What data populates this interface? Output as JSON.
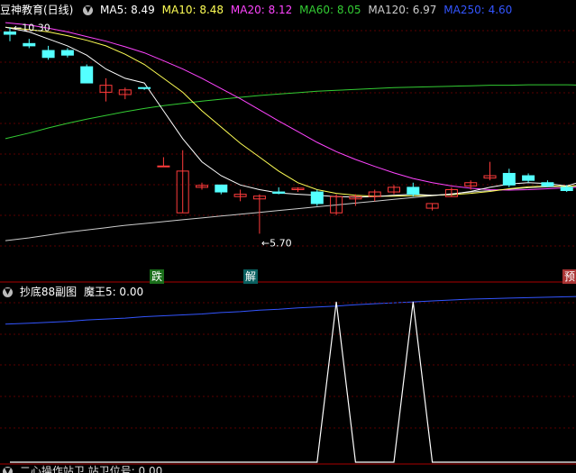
{
  "main_legend": {
    "title": "豆神教育(日线)",
    "ma5": "MA5: 8.49",
    "ma10": "MA10: 8.48",
    "ma20": "MA20: 8.12",
    "ma60": "MA60: 8.05",
    "ma120": "MA120: 6.97",
    "ma250": "MA250: 4.60"
  },
  "high_label": "10.30",
  "low_label": "5.70",
  "tags": {
    "die": "跌",
    "jie": "解",
    "yu": "预"
  },
  "sub_legend": {
    "title": "抄底88副图",
    "value": "魔王5: 0.00"
  },
  "bottom_legend": "二心操作站卫  站卫位号: 0.00",
  "colors": {
    "background": "#000000",
    "grid": "#5a0000",
    "up_candle": "#ff3b3b",
    "down_candle": "#54ffff",
    "ma5": "#ffffff",
    "ma10": "#ffff55",
    "ma20": "#ff44ff",
    "ma60": "#33cc33",
    "ma120": "#cccccc",
    "ma250": "#3355ff",
    "tag_green": "#1a6e1a",
    "tag_teal": "#0a6060",
    "tag_red": "#aa3333"
  },
  "chart_data": {
    "type": "candlestick",
    "price_range": [
      5.2,
      10.6
    ],
    "candles": [
      {
        "o": 10.3,
        "h": 10.4,
        "l": 10.1,
        "c": 10.25
      },
      {
        "o": 10.05,
        "h": 10.15,
        "l": 9.95,
        "c": 10.0
      },
      {
        "o": 9.9,
        "h": 10.0,
        "l": 9.7,
        "c": 9.75
      },
      {
        "o": 9.9,
        "h": 9.95,
        "l": 9.75,
        "c": 9.8
      },
      {
        "o": 9.55,
        "h": 9.6,
        "l": 9.2,
        "c": 9.2
      },
      {
        "o": 9.0,
        "h": 9.3,
        "l": 8.8,
        "c": 9.15
      },
      {
        "o": 8.95,
        "h": 9.1,
        "l": 8.85,
        "c": 9.05
      },
      {
        "o": 9.1,
        "h": 9.1,
        "l": 9.05,
        "c": 9.08
      },
      {
        "o": 7.4,
        "h": 7.6,
        "l": 7.4,
        "c": 7.41
      },
      {
        "o": 6.4,
        "h": 7.75,
        "l": 6.4,
        "c": 7.3
      },
      {
        "o": 6.95,
        "h": 7.05,
        "l": 6.9,
        "c": 6.99
      },
      {
        "o": 7.0,
        "h": 7.0,
        "l": 6.8,
        "c": 6.85
      },
      {
        "o": 6.75,
        "h": 6.9,
        "l": 6.65,
        "c": 6.8
      },
      {
        "o": 6.7,
        "h": 6.8,
        "l": 5.95,
        "c": 6.76
      },
      {
        "o": 6.85,
        "h": 6.95,
        "l": 6.8,
        "c": 6.82
      },
      {
        "o": 6.9,
        "h": 6.95,
        "l": 6.85,
        "c": 6.93
      },
      {
        "o": 6.85,
        "h": 6.9,
        "l": 6.55,
        "c": 6.6
      },
      {
        "o": 6.4,
        "h": 6.8,
        "l": 6.35,
        "c": 6.75
      },
      {
        "o": 6.7,
        "h": 6.8,
        "l": 6.55,
        "c": 6.75
      },
      {
        "o": 6.75,
        "h": 6.9,
        "l": 6.65,
        "c": 6.85
      },
      {
        "o": 6.85,
        "h": 7.0,
        "l": 6.8,
        "c": 6.95
      },
      {
        "o": 6.95,
        "h": 7.05,
        "l": 6.75,
        "c": 6.8
      },
      {
        "o": 6.5,
        "h": 6.6,
        "l": 6.45,
        "c": 6.6
      },
      {
        "o": 6.75,
        "h": 6.95,
        "l": 6.75,
        "c": 6.9
      },
      {
        "o": 6.98,
        "h": 7.1,
        "l": 6.9,
        "c": 7.05
      },
      {
        "o": 7.15,
        "h": 7.5,
        "l": 7.1,
        "c": 7.2
      },
      {
        "o": 7.25,
        "h": 7.35,
        "l": 6.95,
        "c": 7.0
      },
      {
        "o": 7.2,
        "h": 7.25,
        "l": 7.05,
        "c": 7.1
      },
      {
        "o": 7.05,
        "h": 7.1,
        "l": 6.95,
        "c": 6.98
      },
      {
        "o": 6.95,
        "h": 7.0,
        "l": 6.85,
        "c": 6.88
      },
      {
        "o": 7.0,
        "h": 7.9,
        "l": 6.95,
        "c": 7.65
      }
    ],
    "ma_lines": {
      "ma5": [
        10.4,
        10.3,
        10.15,
        10.0,
        9.8,
        9.5,
        9.3,
        9.2,
        8.6,
        8.0,
        7.5,
        7.2,
        7.0,
        6.9,
        6.83,
        6.8,
        6.78,
        6.75,
        6.74,
        6.75,
        6.78,
        6.8,
        6.78,
        6.8,
        6.86,
        6.95,
        7.02,
        7.05,
        7.03,
        6.98,
        7.1
      ],
      "ma10": [
        10.4,
        10.35,
        10.3,
        10.22,
        10.12,
        10.0,
        9.82,
        9.6,
        9.3,
        9.0,
        8.6,
        8.25,
        7.9,
        7.6,
        7.3,
        7.05,
        6.9,
        6.82,
        6.78,
        6.76,
        6.76,
        6.77,
        6.78,
        6.79,
        6.82,
        6.86,
        6.92,
        6.96,
        6.98,
        6.97,
        7.0
      ],
      "ma20": [
        10.5,
        10.45,
        10.38,
        10.3,
        10.2,
        10.1,
        9.98,
        9.85,
        9.68,
        9.5,
        9.3,
        9.08,
        8.86,
        8.62,
        8.38,
        8.15,
        7.92,
        7.72,
        7.55,
        7.4,
        7.26,
        7.14,
        7.05,
        6.98,
        6.93,
        6.9,
        6.89,
        6.9,
        6.92,
        6.94,
        6.96
      ],
      "ma60": [
        8.0,
        8.12,
        8.23,
        8.33,
        8.42,
        8.5,
        8.58,
        8.65,
        8.71,
        8.76,
        8.81,
        8.85,
        8.89,
        8.93,
        8.96,
        8.99,
        9.02,
        9.04,
        9.06,
        9.08,
        9.1,
        9.11,
        9.12,
        9.13,
        9.14,
        9.15,
        9.15,
        9.16,
        9.16,
        9.16,
        9.15
      ],
      "ma120": [
        5.8,
        5.86,
        5.92,
        5.98,
        6.03,
        6.08,
        6.13,
        6.17,
        6.21,
        6.25,
        6.29,
        6.33,
        6.37,
        6.41,
        6.45,
        6.49,
        6.53,
        6.57,
        6.61,
        6.65,
        6.69,
        6.73,
        6.77,
        6.81,
        6.85,
        6.88,
        6.91,
        6.94,
        6.96,
        6.97,
        6.98
      ],
      "ma250": [
        4.0,
        4.02,
        4.04,
        4.06,
        4.09,
        4.11,
        4.13,
        4.16,
        4.18,
        4.2,
        4.22,
        4.25,
        4.27,
        4.3,
        4.32,
        4.35,
        4.37,
        4.39,
        4.42,
        4.44,
        4.46,
        4.48,
        4.5,
        4.52,
        4.54,
        4.55,
        4.56,
        4.57,
        4.58,
        4.59,
        4.6
      ]
    },
    "indicator": {
      "name": "魔王5",
      "range": [
        0,
        1
      ],
      "values": [
        0,
        0,
        0,
        0,
        0,
        0,
        0,
        0,
        0,
        0,
        0,
        0,
        0,
        0,
        0,
        0,
        0,
        1,
        0,
        0,
        0,
        1,
        0,
        0,
        0,
        0,
        0,
        0,
        0,
        0,
        0
      ]
    }
  }
}
